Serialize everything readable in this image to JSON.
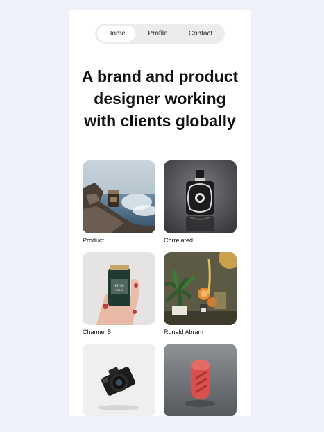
{
  "nav": {
    "items": [
      {
        "label": "Home",
        "active": true
      },
      {
        "label": "Profile",
        "active": false
      },
      {
        "label": "Contact",
        "active": false
      }
    ]
  },
  "hero": {
    "line1": "A brand and product",
    "line2": "designer working",
    "line3": "with clients globally"
  },
  "gallery": {
    "items": [
      {
        "caption": "Product",
        "image": "candle-on-rocks-image"
      },
      {
        "caption": "Correlated",
        "image": "perfume-bottle-image"
      },
      {
        "caption": "Channel 5",
        "image": "hand-holding-jar-image"
      },
      {
        "caption": "Ronald Abram",
        "image": "plant-and-oranges-image"
      },
      {
        "caption": "",
        "image": "camera-image"
      },
      {
        "caption": "",
        "image": "red-object-image"
      }
    ]
  },
  "colors": {
    "page_background": "#eef1f8",
    "card_background": "#ffffff",
    "nav_background": "#ececec"
  }
}
